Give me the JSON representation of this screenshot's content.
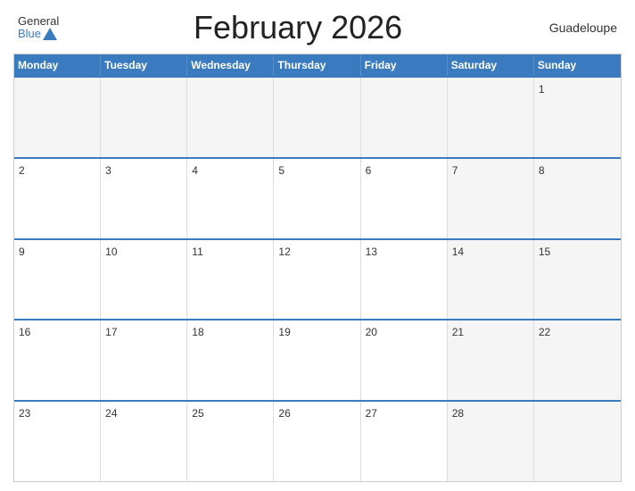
{
  "header": {
    "logo_general": "General",
    "logo_blue": "Blue",
    "title": "February 2026",
    "region": "Guadeloupe"
  },
  "weekdays": [
    "Monday",
    "Tuesday",
    "Wednesday",
    "Thursday",
    "Friday",
    "Saturday",
    "Sunday"
  ],
  "weeks": [
    [
      {
        "num": "",
        "empty": true
      },
      {
        "num": "",
        "empty": true
      },
      {
        "num": "",
        "empty": true
      },
      {
        "num": "",
        "empty": true
      },
      {
        "num": "",
        "empty": true
      },
      {
        "num": "",
        "empty": true
      },
      {
        "num": "1",
        "empty": false
      }
    ],
    [
      {
        "num": "2",
        "empty": false
      },
      {
        "num": "3",
        "empty": false
      },
      {
        "num": "4",
        "empty": false
      },
      {
        "num": "5",
        "empty": false
      },
      {
        "num": "6",
        "empty": false
      },
      {
        "num": "7",
        "empty": false
      },
      {
        "num": "8",
        "empty": false
      }
    ],
    [
      {
        "num": "9",
        "empty": false
      },
      {
        "num": "10",
        "empty": false
      },
      {
        "num": "11",
        "empty": false
      },
      {
        "num": "12",
        "empty": false
      },
      {
        "num": "13",
        "empty": false
      },
      {
        "num": "14",
        "empty": false
      },
      {
        "num": "15",
        "empty": false
      }
    ],
    [
      {
        "num": "16",
        "empty": false
      },
      {
        "num": "17",
        "empty": false
      },
      {
        "num": "18",
        "empty": false
      },
      {
        "num": "19",
        "empty": false
      },
      {
        "num": "20",
        "empty": false
      },
      {
        "num": "21",
        "empty": false
      },
      {
        "num": "22",
        "empty": false
      }
    ],
    [
      {
        "num": "23",
        "empty": false
      },
      {
        "num": "24",
        "empty": false
      },
      {
        "num": "25",
        "empty": false
      },
      {
        "num": "26",
        "empty": false
      },
      {
        "num": "27",
        "empty": false
      },
      {
        "num": "28",
        "empty": false
      },
      {
        "num": "",
        "empty": true
      }
    ]
  ],
  "colors": {
    "header_bg": "#3a7abf",
    "row_border": "#3a7abf",
    "alt_cell": "#f5f5f5"
  }
}
